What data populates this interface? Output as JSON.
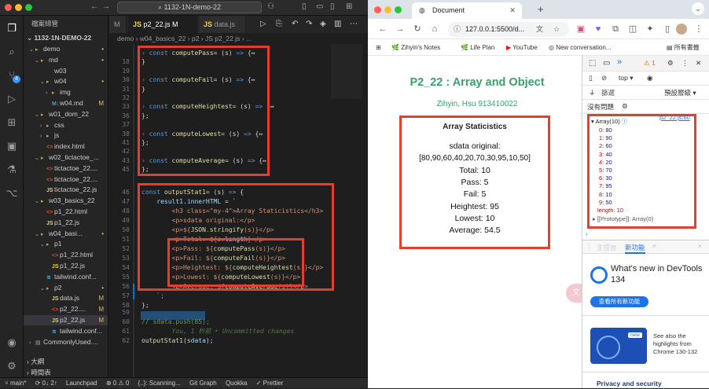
{
  "vscode": {
    "search_title": "1132-1N-demo-22",
    "sidebar": {
      "header": "檔案總管",
      "root": "1132-1N-DEMO-22",
      "items": [
        {
          "label": "demo",
          "icon": "folder-icon",
          "chev": "⌄",
          "status": "•"
        },
        {
          "label": "md",
          "icon": "folder-icon",
          "chev": "⌄",
          "status": "•"
        },
        {
          "label": "w03",
          "icon": "",
          "chev": "",
          "status": ""
        },
        {
          "label": "w04",
          "icon": "folder-icon",
          "chev": "⌄",
          "status": "•"
        },
        {
          "label": "img",
          "icon": "folder-icon",
          "chev": "›",
          "status": ""
        },
        {
          "label": "w04.md",
          "icon": "markdown-icon",
          "chev": "",
          "status": "M"
        },
        {
          "label": "w01_dom_22",
          "icon": "folder-icon",
          "chev": "⌄",
          "status": ""
        },
        {
          "label": "css",
          "icon": "folder-icon",
          "chev": "›",
          "status": ""
        },
        {
          "label": "js",
          "icon": "folder-icon",
          "chev": "›",
          "status": ""
        },
        {
          "label": "index.html",
          "icon": "html-icon",
          "chev": "",
          "status": ""
        },
        {
          "label": "w02_tictactoe_...",
          "icon": "folder-icon",
          "chev": "⌄",
          "status": ""
        },
        {
          "label": "tictactoe_22....",
          "icon": "html-icon",
          "chev": "",
          "status": ""
        },
        {
          "label": "tictactoe_22....",
          "icon": "html-icon",
          "chev": "",
          "status": ""
        },
        {
          "label": "tictactoe_22.js",
          "icon": "js-icon",
          "chev": "",
          "status": ""
        },
        {
          "label": "w03_basics_22",
          "icon": "folder-icon",
          "chev": "⌄",
          "status": ""
        },
        {
          "label": "p1_22.html",
          "icon": "html-icon",
          "chev": "",
          "status": ""
        },
        {
          "label": "p1_22.js",
          "icon": "js-icon",
          "chev": "",
          "status": ""
        },
        {
          "label": "w04_basi...",
          "icon": "folder-icon",
          "chev": "⌄",
          "status": "•"
        },
        {
          "label": "p1",
          "icon": "folder-icon",
          "chev": "⌄",
          "status": ""
        },
        {
          "label": "p1_22.html",
          "icon": "html-icon",
          "chev": "",
          "status": ""
        },
        {
          "label": "p1_22.js",
          "icon": "js-icon",
          "chev": "",
          "status": ""
        },
        {
          "label": "tailwind.conf...",
          "icon": "gear-icon",
          "chev": "",
          "status": ""
        },
        {
          "label": "p2",
          "icon": "folder-icon",
          "chev": "⌄",
          "status": "•"
        },
        {
          "label": "data.js",
          "icon": "js-icon",
          "chev": "",
          "status": "M"
        },
        {
          "label": "p2_22....",
          "icon": "html-icon",
          "chev": "",
          "status": "M"
        },
        {
          "label": "p2_22.js",
          "icon": "js-icon",
          "chev": "",
          "status": "M"
        },
        {
          "label": "tailwind.conf...",
          "icon": "gear-icon",
          "chev": "",
          "status": ""
        },
        {
          "label": "CommonlyUsed....",
          "icon": "file-icon",
          "chev": "›",
          "status": ""
        }
      ],
      "outline": "大綱",
      "timeline": "時間表"
    },
    "tabs": [
      {
        "label": "M"
      },
      {
        "label": "p2_22.js  M"
      },
      {
        "label": "data.js"
      }
    ],
    "breadcrumb": "demo › w04_basics_22 › p2 › JS p2_22.js › ...",
    "code_lines": [
      {
        "no": "",
        "tokens": [
          [
            "kw",
            "› const "
          ],
          [
            "fn",
            "computePass"
          ],
          [
            "",
            "= (s) "
          ],
          [
            "kw",
            "=> "
          ],
          [
            "",
            "{↔"
          ]
        ]
      },
      {
        "no": "18",
        "tokens": [
          [
            "",
            "}"
          ]
        ]
      },
      {
        "no": "19",
        "tokens": [
          [
            "",
            ""
          ]
        ]
      },
      {
        "no": "30",
        "tokens": [
          [
            "kw",
            "› const "
          ],
          [
            "fn",
            "computeFail"
          ],
          [
            "",
            "= (s) "
          ],
          [
            "kw",
            "=> "
          ],
          [
            "",
            "{↔"
          ]
        ]
      },
      {
        "no": "31",
        "tokens": [
          [
            "",
            "}"
          ]
        ]
      },
      {
        "no": "32",
        "tokens": [
          [
            "",
            ""
          ]
        ]
      },
      {
        "no": "33",
        "tokens": [
          [
            "kw",
            "› const "
          ],
          [
            "fn",
            "computeHeightest"
          ],
          [
            "",
            "= (s) "
          ],
          [
            "kw",
            "=> "
          ],
          [
            "",
            "{↔"
          ]
        ]
      },
      {
        "no": "36",
        "tokens": [
          [
            "",
            "};"
          ]
        ]
      },
      {
        "no": "37",
        "tokens": [
          [
            "",
            ""
          ]
        ]
      },
      {
        "no": "38",
        "tokens": [
          [
            "kw",
            "› const "
          ],
          [
            "fn",
            "computeLowest"
          ],
          [
            "",
            "= (s) "
          ],
          [
            "kw",
            "=> "
          ],
          [
            "",
            "{↔"
          ]
        ]
      },
      {
        "no": "41",
        "tokens": [
          [
            "",
            "};"
          ]
        ]
      },
      {
        "no": "42",
        "tokens": [
          [
            "",
            ""
          ]
        ]
      },
      {
        "no": "43",
        "tokens": [
          [
            "kw",
            "› const "
          ],
          [
            "fn",
            "computeAverage"
          ],
          [
            "",
            "= (s) "
          ],
          [
            "kw",
            "=> "
          ],
          [
            "",
            "{↔"
          ]
        ]
      },
      {
        "no": "45",
        "tokens": [
          [
            "",
            "};"
          ]
        ]
      },
      {
        "no": "46",
        "tokens": [
          [
            "kw",
            "const "
          ],
          [
            "fn",
            "outputStat1"
          ],
          [
            "",
            "= (s) "
          ],
          [
            "kw",
            "=> "
          ],
          [
            "",
            "{"
          ]
        ]
      },
      {
        "no": "47",
        "tokens": [
          [
            "",
            "    "
          ],
          [
            "vr",
            "result1"
          ],
          [
            "",
            "."
          ],
          [
            "vr",
            "innerHTML"
          ],
          [
            "",
            " = `"
          ]
        ]
      },
      {
        "no": "48",
        "tokens": [
          [
            "",
            "        "
          ],
          [
            "str",
            "<h3 class=\"my-4\">Array Staticistics</h3>"
          ]
        ]
      },
      {
        "no": "49",
        "tokens": [
          [
            "",
            "        "
          ],
          [
            "str",
            "<p>sdata original:</p>"
          ]
        ]
      },
      {
        "no": "50",
        "tokens": [
          [
            "",
            "        "
          ],
          [
            "str",
            "<p>${"
          ],
          [
            "fn",
            "JSON"
          ],
          [
            "str",
            "."
          ],
          [
            "fn",
            "stringify"
          ],
          [
            "str",
            "(s)}</p>"
          ]
        ]
      },
      {
        "no": "51",
        "tokens": [
          [
            "",
            "        "
          ],
          [
            "str",
            "<p>Total: ${s."
          ],
          [
            "vr",
            "length"
          ],
          [
            "str",
            "}</p>"
          ]
        ]
      },
      {
        "no": "52",
        "tokens": [
          [
            "",
            "        "
          ],
          [
            "str",
            "<p>Pass: ${"
          ],
          [
            "fn",
            "computePass"
          ],
          [
            "str",
            "(s)}</p>"
          ]
        ]
      },
      {
        "no": "53",
        "tokens": [
          [
            "",
            "        "
          ],
          [
            "str",
            "<p>Fail: ${"
          ],
          [
            "fn",
            "computeFail"
          ],
          [
            "str",
            "(s)}</p>"
          ]
        ]
      },
      {
        "no": "54",
        "tokens": [
          [
            "",
            "        "
          ],
          [
            "str",
            "<p>Heightest: ${"
          ],
          [
            "fn",
            "computeHeightest"
          ],
          [
            "str",
            "(s)}</p>"
          ]
        ]
      },
      {
        "no": "55",
        "tokens": [
          [
            "",
            "        "
          ],
          [
            "str",
            "<p>Lowest: ${"
          ],
          [
            "fn",
            "computeLowest"
          ],
          [
            "str",
            "(s)}</p>"
          ]
        ]
      },
      {
        "no": "56",
        "tokens": [
          [
            "",
            "        "
          ],
          [
            "str",
            "<p>Average: ${"
          ],
          [
            "fn",
            "computeAverage"
          ],
          [
            "str",
            "(s)}</p>"
          ]
        ]
      },
      {
        "no": "57",
        "tokens": [
          [
            "",
            "    "
          ],
          [
            "str",
            "`;"
          ]
        ]
      },
      {
        "no": "58",
        "tokens": [
          [
            "",
            "};"
          ]
        ]
      },
      {
        "no": "59",
        "tokens": [
          [
            "",
            ""
          ]
        ]
      },
      {
        "no": "60",
        "tokens": [
          [
            "cm",
            "// sdata.push(85);"
          ]
        ]
      },
      {
        "no": "61",
        "tokens": [
          [
            "cm",
            "        You, 1 秒前 • Uncommitted changes"
          ]
        ]
      },
      {
        "no": "62",
        "tokens": [
          [
            "fn",
            "outputStat1"
          ],
          [
            "",
            "("
          ],
          [
            "vr",
            "sdata"
          ],
          [
            "",
            ");"
          ]
        ]
      }
    ],
    "status_bar": [
      "⑂ main*",
      "⟳ 0↓ 2↑",
      "⊗ 0 ⚠ 0",
      "{..}: Scanning...",
      "Git Graph",
      "Quokka",
      "✓ Prettier"
    ],
    "launchpad": "Launchpad"
  },
  "chrome": {
    "tab_title": "Document",
    "url": "127.0.0.1:5500/d...",
    "bookmarks": [
      "Zihyin's Notes",
      "Life Plan",
      "YouTube",
      "New conversation..."
    ],
    "all_bookmarks": "所有書籤",
    "page": {
      "title": "P2_22 : Array and Object",
      "subtitle": "Zihyin, Hsu 913410022",
      "card_title": "Array Staticistics",
      "lines": [
        "sdata original:",
        "[80,90,60,40,20,70,30,95,10,50]",
        "Total: 10",
        "Pass: 5",
        "Fail: 5",
        "Heightest: 95",
        "Lowest: 10",
        "Average: 54.5"
      ]
    },
    "devtools": {
      "warnings": "1",
      "context": "top",
      "filter_label": "篩選",
      "levels_label": "預設層級",
      "no_issues": "沒有問題",
      "source_link": "p2_22.js:60",
      "array_header": "Array(10)",
      "array_items": [
        {
          "i": "0",
          "v": "80"
        },
        {
          "i": "1",
          "v": "90"
        },
        {
          "i": "2",
          "v": "60"
        },
        {
          "i": "3",
          "v": "40"
        },
        {
          "i": "4",
          "v": "20"
        },
        {
          "i": "5",
          "v": "70"
        },
        {
          "i": "6",
          "v": "30"
        },
        {
          "i": "7",
          "v": "95"
        },
        {
          "i": "8",
          "v": "10"
        },
        {
          "i": "9",
          "v": "50"
        }
      ],
      "length_line": "length: 10",
      "prototype_line": "▸ [[Prototype]]: Array(0)",
      "drawer_tab1": "主控台",
      "drawer_tab2": "新功能",
      "whats_new_title": "What's new in DevTools 134",
      "whats_new_button": "查看所有新功能",
      "see_also": "See also the highlights from Chrome 130-132",
      "privacy": "Privacy and security"
    }
  }
}
